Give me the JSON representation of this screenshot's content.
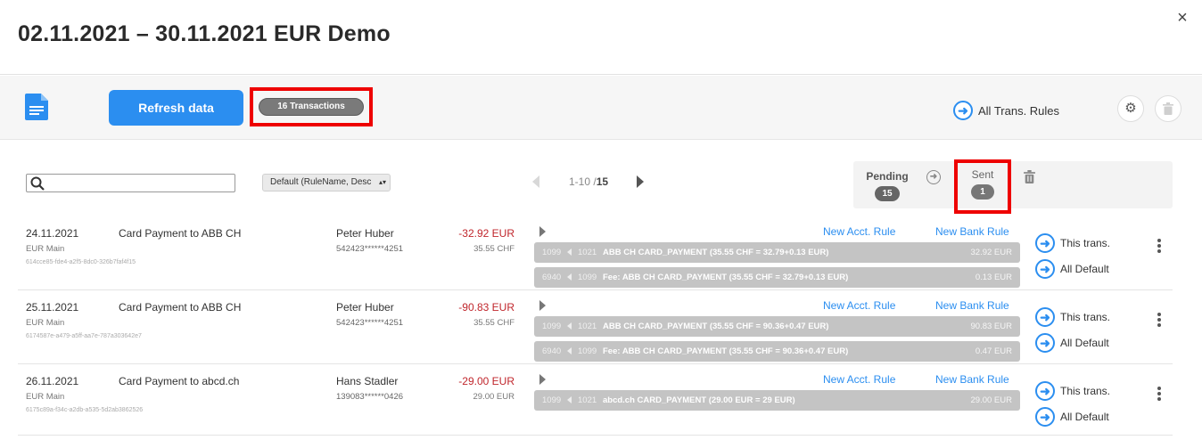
{
  "header": {
    "title": "02.11.2021 – 30.11.2021 EUR Demo",
    "close_icon": "×"
  },
  "toolbar": {
    "doc_icon": "document-icon",
    "refresh_label": "Refresh data",
    "transactions_badge": "16 Transactions",
    "all_rules_label": "All Trans. Rules",
    "settings_glyph": "⚙",
    "trash_glyph": "🗑",
    "accent_color": "#2b8ef0"
  },
  "filters": {
    "search_value": "",
    "sort_selected": "Default (RuleName, Desc"
  },
  "pager": {
    "range": "1-10 / ",
    "total": "15"
  },
  "status": {
    "pending_label": "Pending",
    "pending_count": "15",
    "sent_label": "Sent",
    "sent_count": "1"
  },
  "rows": [
    {
      "date": "24.11.2021",
      "description": "Card Payment to ABB CH",
      "account": "EUR Main",
      "uuid": "614cce85-fde4-a2f5-8dc0-326b7faf4f15",
      "name": "Peter Huber",
      "card": "542423******4251",
      "amount": "-32.92 EUR",
      "orig_amount": "35.55 CHF",
      "acct_rule": "New Acct. Rule",
      "bank_rule": "New Bank Rule",
      "this_trans": "This trans.",
      "all_default": "All Default",
      "entries": [
        {
          "from": "1099",
          "to": "1021",
          "text": "ABB CH CARD_PAYMENT (35.55 CHF = 32.79+0.13 EUR)",
          "amount": "32.92 EUR"
        },
        {
          "from": "6940",
          "to": "1099",
          "text": "Fee: ABB CH CARD_PAYMENT (35.55 CHF = 32.79+0.13 EUR)",
          "amount": "0.13 EUR"
        }
      ]
    },
    {
      "date": "25.11.2021",
      "description": "Card Payment to ABB CH",
      "account": "EUR Main",
      "uuid": "6174587e-a479-a5ff-aa7e-787a303642e7",
      "name": "Peter Huber",
      "card": "542423******4251",
      "amount": "-90.83 EUR",
      "orig_amount": "35.55 CHF",
      "acct_rule": "New Acct. Rule",
      "bank_rule": "New Bank Rule",
      "this_trans": "This trans.",
      "all_default": "All Default",
      "entries": [
        {
          "from": "1099",
          "to": "1021",
          "text": "ABB CH CARD_PAYMENT (35.55 CHF = 90.36+0.47 EUR)",
          "amount": "90.83 EUR"
        },
        {
          "from": "6940",
          "to": "1099",
          "text": "Fee: ABB CH CARD_PAYMENT (35.55 CHF = 90.36+0.47 EUR)",
          "amount": "0.47 EUR"
        }
      ]
    },
    {
      "date": "26.11.2021",
      "description": "Card Payment to abcd.ch",
      "account": "EUR Main",
      "uuid": "6175c89a-f34c-a2db-a535-5d2ab3862526",
      "name": "Hans Stadler",
      "card": "139083******0426",
      "amount": "-29.00 EUR",
      "orig_amount": "29.00 EUR",
      "acct_rule": "New Acct. Rule",
      "bank_rule": "New Bank Rule",
      "this_trans": "This trans.",
      "all_default": "All Default",
      "entries": [
        {
          "from": "1099",
          "to": "1021",
          "text": "abcd.ch CARD_PAYMENT (29.00 EUR = 29 EUR)",
          "amount": "29.00 EUR"
        }
      ]
    }
  ]
}
